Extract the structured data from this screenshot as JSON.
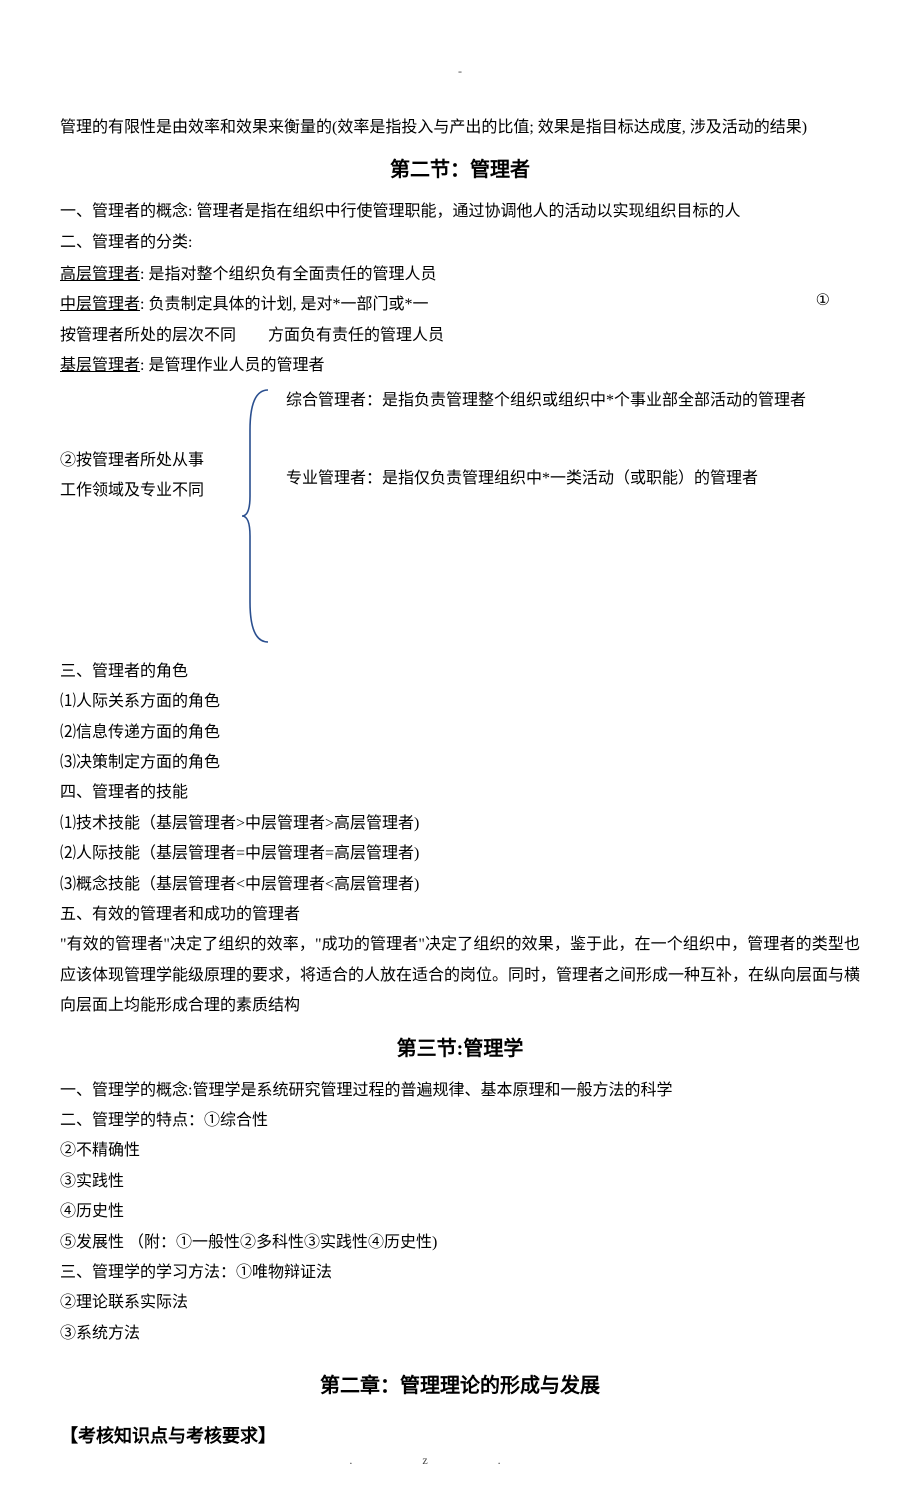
{
  "header_dash": "-",
  "intro": "管理的有限性是由效率和效果来衡量的(效率是指投入与产出的比值; 效果是指目标达成度, 涉及活动的结果)",
  "s2": {
    "title": "第二节：管理者",
    "p1": "一、管理者的概念: 管理者是指在组织中行使管理职能，通过协调他人的活动以实现组织目标的人",
    "p2": "二、管理者的分类:",
    "high_label": "高层管理者",
    "high_text": ": 是指对整个组织负有全面责任的管理人员",
    "mid_label": "中层管理者",
    "mid_text": ": 负责制定具体的计划, 是对*一部门或*一",
    "layer_text": "按管理者所处的层次不同  方面负有责任的管理人员",
    "base_label": "基层管理者",
    "base_text": ": 是管理作业人员的管理者",
    "margin_num": "①",
    "comp1": "综合管理者：是指负责管理整个组织或组织中*个事业部全部活动的管理者",
    "cat2_l1": "②按管理者所处从事",
    "cat2_l2": "工作领域及专业不同",
    "comp2": "专业管理者：是指仅负责管理组织中*一类活动（或职能）的管理者",
    "p3": "三、管理者的角色",
    "r1": "⑴人际关系方面的角色",
    "r2": "⑵信息传递方面的角色",
    "r3": "⑶决策制定方面的角色",
    "p4": "四、管理者的技能",
    "sk1": "⑴技术技能（基层管理者>中层管理者>高层管理者)",
    "sk2": "⑵人际技能（基层管理者=中层管理者=高层管理者)",
    "sk3": "⑶概念技能（基层管理者<中层管理者<高层管理者)",
    "p5": "五、有效的管理者和成功的管理者",
    "p5a": "\"有效的管理者\"决定了组织的效率，\"成功的管理者\"决定了组织的效果，鉴于此，在一个组织中，管理者的类型也应该体现管理学能级原理的要求，将适合的人放在适合的岗位。同时，管理者之间形成一种互补，在纵向层面与横向层面上均能形成合理的素质结构"
  },
  "s3": {
    "title": "第三节:管理学",
    "p1": "一、管理学的概念:管理学是系统研究管理过程的普遍规律、基本原理和一般方法的科学",
    "p2": "二、管理学的特点：①综合性",
    "f2": "②不精确性",
    "f3": "③实践性",
    "f4": "④历史性",
    "f5": "⑤发展性  （附：①一般性②多科性③实践性④历史性)",
    "p3": "三、管理学的学习方法：①唯物辩证法",
    "m2": "②理论联系实际法",
    "m3": "③系统方法"
  },
  "ch2": {
    "title": "第二章：管理理论的形成与发展",
    "sub": "【考核知识点与考核要求】"
  },
  "footer": ".z."
}
